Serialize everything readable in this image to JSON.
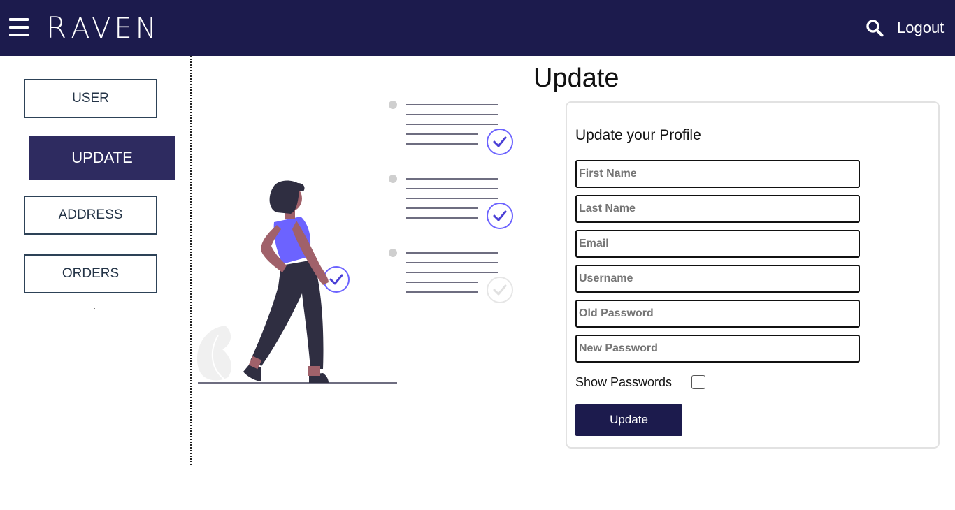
{
  "header": {
    "brand_initial": "R",
    "brand_rest": "AVEN",
    "logout_label": "Logout",
    "icons": [
      "menu-icon",
      "search-icon"
    ]
  },
  "sidebar": {
    "items": [
      {
        "label": "USER",
        "active": false
      },
      {
        "label": "UPDATE",
        "active": true
      },
      {
        "label": "ADDRESS",
        "active": false
      },
      {
        "label": "ORDERS",
        "active": false
      }
    ]
  },
  "main": {
    "title": "Update"
  },
  "form": {
    "heading": "Update your Profile",
    "fields": [
      {
        "placeholder": "First Name",
        "value": ""
      },
      {
        "placeholder": "Last Name",
        "value": ""
      },
      {
        "placeholder": "Email",
        "value": ""
      },
      {
        "placeholder": "Username",
        "value": ""
      },
      {
        "placeholder": "Old Password",
        "value": ""
      },
      {
        "placeholder": "New Password",
        "value": ""
      }
    ],
    "show_passwords_label": "Show Passwords",
    "show_passwords_checked": false,
    "submit_label": "Update"
  },
  "colors": {
    "header_bg": "#1c1b4d",
    "active_nav": "#2e2b60",
    "accent": "#6c63ff",
    "figure_dark": "#2f2e41"
  }
}
